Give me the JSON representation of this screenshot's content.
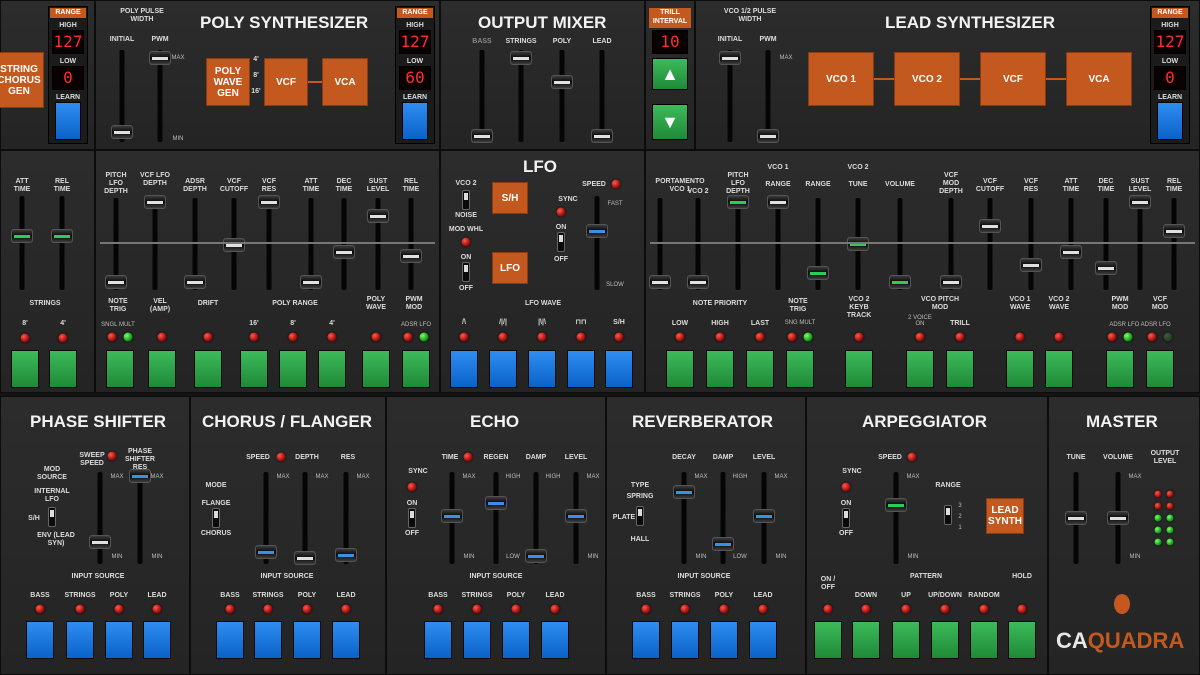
{
  "top": {
    "range_label": "RANGE",
    "high_label": "HIGH",
    "low_label": "LOW",
    "learn_label": "LEARN",
    "string_chorus_gen": "STRING CHORUS GEN",
    "strings_left": {
      "high": "127",
      "low": "0"
    },
    "poly_pulse_width": "POLY PULSE WIDTH",
    "initial": "INITIAL",
    "pwm": "PWM",
    "max": "MAX",
    "min": "MIN",
    "poly_synth": {
      "title": "POLY SYNTHESIZER",
      "wave_gen": "POLY WAVE GEN",
      "vcf": "VCF",
      "vca": "VCA",
      "feet": [
        "4'",
        "8'",
        "16'"
      ],
      "high": "127",
      "low": "60"
    },
    "mixer": {
      "title": "OUTPUT MIXER",
      "channels": [
        "BASS",
        "STRINGS",
        "POLY",
        "LEAD"
      ]
    },
    "lfo": {
      "title": "LFO",
      "vco2": "VCO 2",
      "noise": "NOISE",
      "sh": "S/H",
      "lfo": "LFO",
      "mod_whl": "MOD WHL",
      "on": "ON",
      "off": "OFF",
      "sync": "SYNC",
      "speed": "SPEED",
      "fast": "FAST",
      "slow": "SLOW",
      "wave_label": "LFO WAVE",
      "waves": [
        "/\\",
        "/|/|",
        "|\\|\\",
        "⊓⊓",
        "S/H"
      ]
    },
    "trill": {
      "label": "TRILL INTERVAL",
      "value": "10",
      "up": "▲",
      "down": "▼"
    },
    "vco12_pw": "VCO 1/2 PULSE WIDTH",
    "lead_synth": {
      "title": "LEAD SYNTHESIZER",
      "vco1": "VCO 1",
      "vco2": "VCO 2",
      "vcf": "VCF",
      "vca": "VCA",
      "high": "127",
      "low": "0"
    }
  },
  "mid": {
    "left_sliders": [
      "ATT TIME",
      "REL TIME"
    ],
    "strings": "STRINGS",
    "feet": [
      "8'",
      "4'"
    ],
    "poly_sliders": [
      "PITCH LFO DEPTH",
      "VCF LFO DEPTH",
      "ADSR DEPTH",
      "VCF CUTOFF",
      "VCF RES",
      "ATT TIME",
      "DEC TIME",
      "SUST LEVEL",
      "REL TIME"
    ],
    "note_trig": "NOTE TRIG",
    "sngl_mult": "SNGL MULT",
    "vel_amp": "VEL (AMP)",
    "drift": "DRIFT",
    "poly_range": "POLY RANGE",
    "poly_range_vals": [
      "16'",
      "8'",
      "4'"
    ],
    "poly_wave": "POLY WAVE",
    "pwm_mod": "PWM MOD",
    "adsr_lfo": "ADSR LFO",
    "lead_sliders": [
      "PORTAMENTO VCO 1",
      "VCO 2",
      "PITCH LFO DEPTH",
      "RANGE",
      "RANGE",
      "TUNE",
      "VOLUME",
      "VCF MOD DEPTH",
      "VCF CUTOFF",
      "VCF RES",
      "ATT TIME",
      "DEC TIME",
      "SUST LEVEL",
      "REL TIME"
    ],
    "vco1": "VCO 1",
    "vco2": "VCO 2",
    "range_vals": [
      "2'",
      "4'",
      "8'",
      "16'",
      "32'"
    ],
    "note_priority": "NOTE PRIORITY",
    "np_opts": [
      "LOW",
      "HIGH",
      "LAST",
      "SNG MULT"
    ],
    "vco2_keyb": "VCO 2 KEYB TRACK",
    "vco_pitch_mod": "VCO PITCH MOD",
    "two_voice": "2 VOICE ON",
    "trill": "TRILL",
    "vco1_wave": "VCO 1 WAVE",
    "vco2_wave": "VCO 2 WAVE",
    "vcf_mod": "VCF MOD",
    "adsr_lfo_2": "ADSR LFO ADSR LFO"
  },
  "bottom": {
    "phase": {
      "title": "PHASE SHIFTER",
      "mod_source": "MOD SOURCE",
      "internal_lfo": "INTERNAL LFO",
      "sh": "S/H",
      "env": "ENV (LEAD SYN)",
      "sweep_speed": "SWEEP SPEED",
      "phase_res": "PHASE SHIFTER RES"
    },
    "chorus": {
      "title": "CHORUS / FLANGER",
      "speed": "SPEED",
      "depth": "DEPTH",
      "res": "RES",
      "mode": "MODE",
      "flange": "FLANGE",
      "chorus": "CHORUS"
    },
    "echo": {
      "title": "ECHO",
      "time": "TIME",
      "regen": "REGEN",
      "damp": "DAMP",
      "level": "LEVEL",
      "sync": "SYNC",
      "on": "ON",
      "off": "OFF"
    },
    "reverb": {
      "title": "REVERBERATOR",
      "decay": "DECAY",
      "damp": "DAMP",
      "level": "LEVEL",
      "type": "TYPE",
      "spring": "SPRING",
      "plate": "PLATE",
      "hall": "HALL"
    },
    "arp": {
      "title": "ARPEGGIATOR",
      "speed": "SPEED",
      "sync": "SYNC",
      "range": "RANGE",
      "range_vals": [
        "3",
        "2",
        "1"
      ],
      "lead_synth": "LEAD SYNTH",
      "on_off": "ON / OFF",
      "pattern": "PATTERN",
      "hold": "HOLD",
      "opts": [
        "DOWN",
        "UP",
        "UP/DOWN",
        "RANDOM"
      ]
    },
    "master": {
      "title": "MASTER",
      "tune": "TUNE",
      "volume": "VOLUME",
      "output_level": "OUTPUT LEVEL",
      "logo_ca": "CA",
      "logo_quadra": "QUADRA"
    },
    "input_source": "INPUT SOURCE",
    "sources": [
      "BASS",
      "STRINGS",
      "POLY",
      "LEAD"
    ],
    "max": "MAX",
    "min": "MIN",
    "high": "HIGH",
    "low": "LOW"
  },
  "colors": {
    "orange": "#c4591f",
    "green": "#2ecc57",
    "blue": "#0a62c8",
    "red": "#ff2d2d"
  }
}
